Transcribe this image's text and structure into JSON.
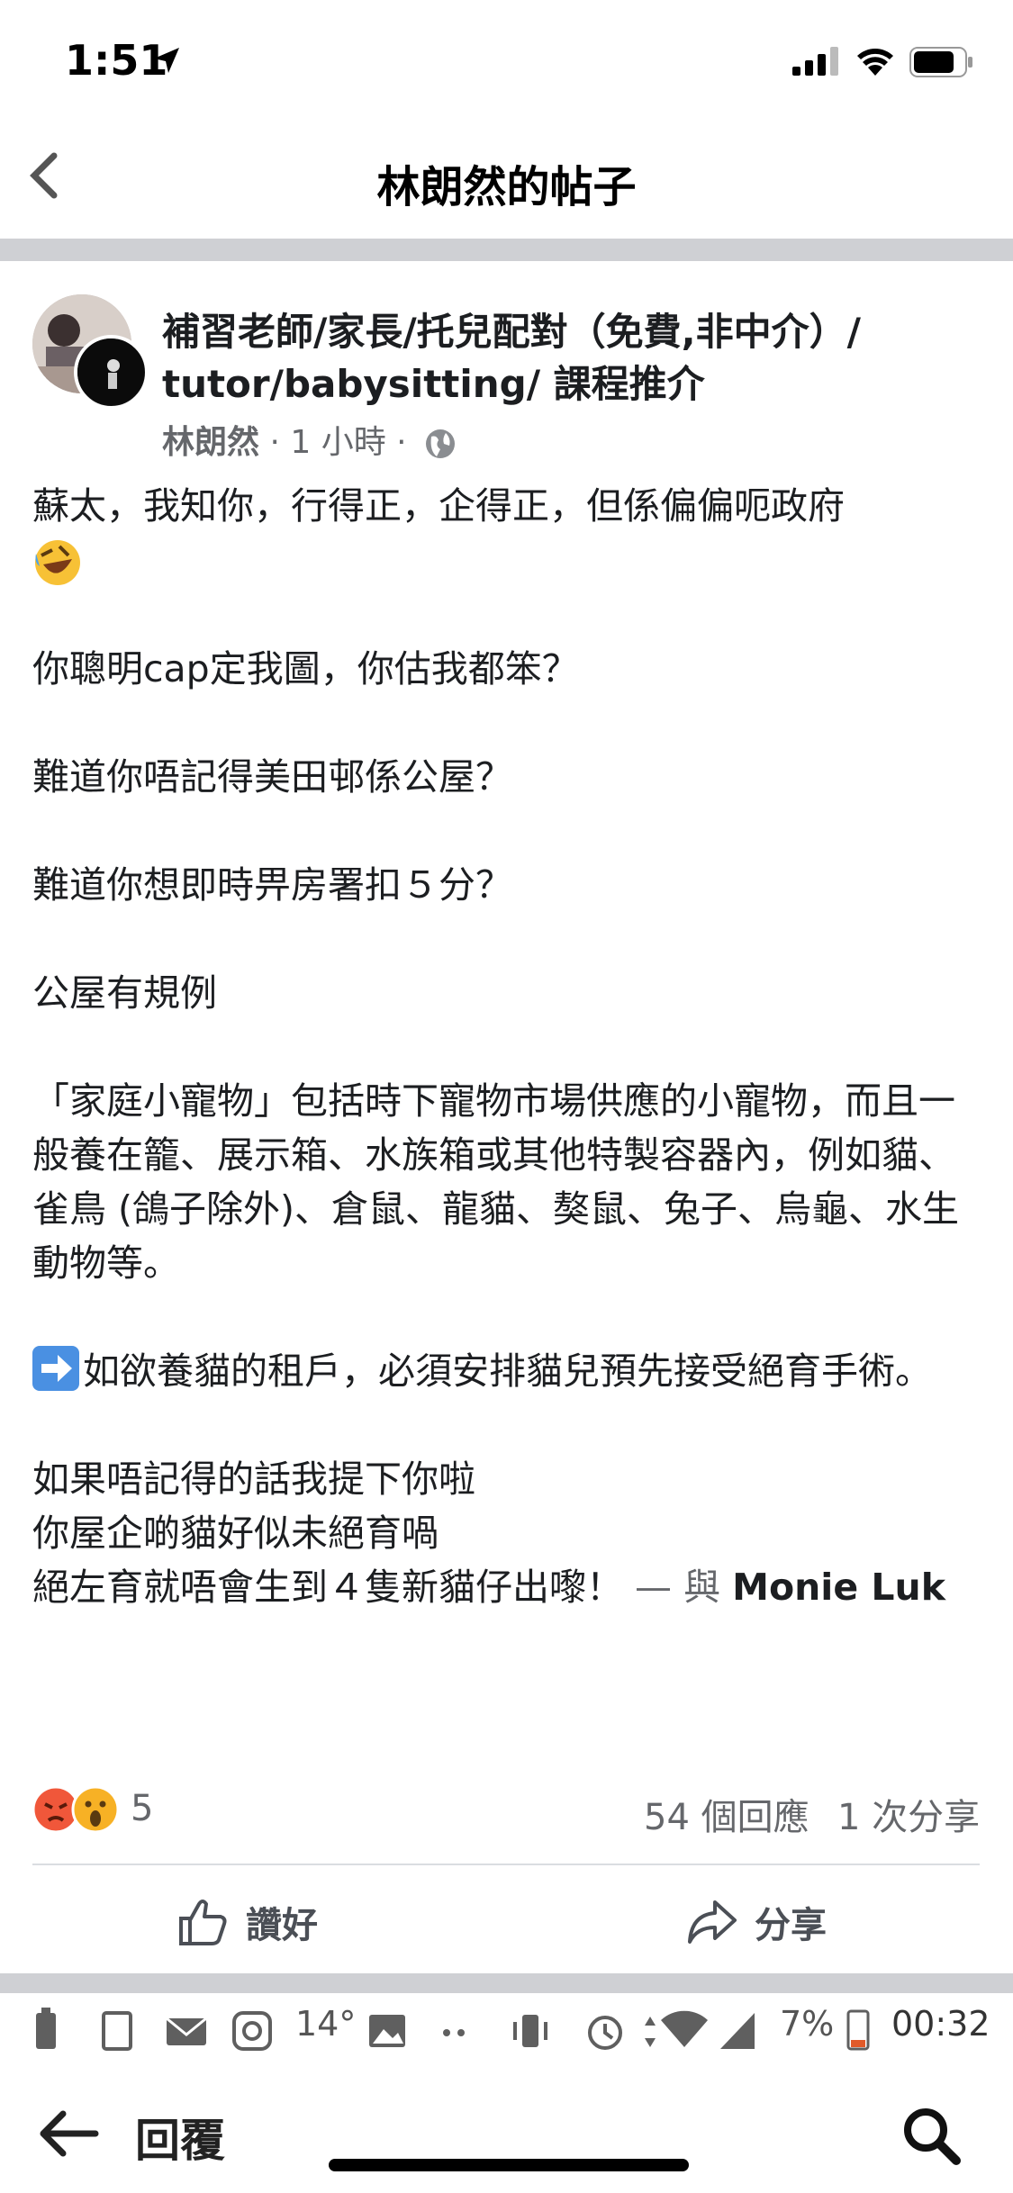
{
  "status_bar": {
    "time": "1:51"
  },
  "header": {
    "title": "林朗然的帖子"
  },
  "post": {
    "group_name": "補習老師/家長/托兒配對（免費,非中介）/ tutor/babysitting/ 課程推介",
    "author": "林朗然",
    "time": "· 1 小時 ·",
    "body": {
      "line1": "蘇太，我知你，行得正，企得正，但係偏偏呃政府",
      "p2": "你聰明cap定我圖，你估我都笨？",
      "p3": "難道你唔記得美田邨係公屋？",
      "p4": "難道你想即時畀房署扣５分？",
      "p5": "公屋有規例",
      "p6": "「家庭小寵物」包括時下寵物市場供應的小寵物，而且一般養在籠、展示箱、水族箱或其他特製容器內，例如貓、雀鳥 (鴿子除外)、倉鼠、龍貓、獒鼠、兔子、烏龜、水生動物等。",
      "p7": "如欲養貓的租戶，必須安排貓兒預先接受絕育手術。",
      "p8a": "如果唔記得的話我提下你啦",
      "p8b": "你屋企啲貓好似未絕育喎",
      "p8c": "絕左育就唔會生到４隻新貓仔出嚟！",
      "with_text": "— 與",
      "tagged": "Monie Luk"
    },
    "reactions": {
      "count": "5",
      "types": [
        "angry",
        "wow"
      ]
    },
    "comments": "54 個回應",
    "shares": "1 次分享",
    "actions": {
      "like": "讚好",
      "share": "分享"
    }
  },
  "android_bar": {
    "temp": "14°",
    "battery": "7%",
    "time": "00:32"
  },
  "reply_bar": {
    "label": "回覆"
  },
  "colors": {
    "divider": "#cfd0d4",
    "meta": "#65676b",
    "angry": "#f0573a",
    "wow": "#f7b125"
  }
}
